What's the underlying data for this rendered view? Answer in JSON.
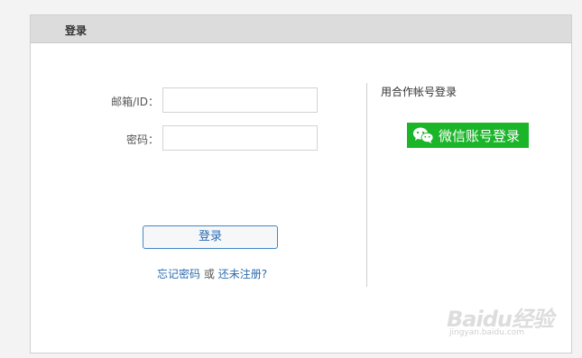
{
  "header": {
    "title": "登录"
  },
  "form": {
    "email_label": "邮箱/ID：",
    "email_value": "",
    "password_label": "密码：",
    "password_value": "",
    "submit_label": "登录"
  },
  "links": {
    "forgot_password": "忘记密码",
    "or_text": "或",
    "register": "还未注册?"
  },
  "partner": {
    "title": "用合作帐号登录",
    "wechat_label": "微信账号登录",
    "wechat_icon": "wechat-icon",
    "wechat_color": "#1bb52a"
  },
  "watermark": {
    "brand": "Baidu经验",
    "url": "jingyan.baidu.com"
  },
  "colors": {
    "link": "#2a6cb0",
    "button_border": "#3f88c5",
    "header_bg": "#dcdcdc"
  }
}
